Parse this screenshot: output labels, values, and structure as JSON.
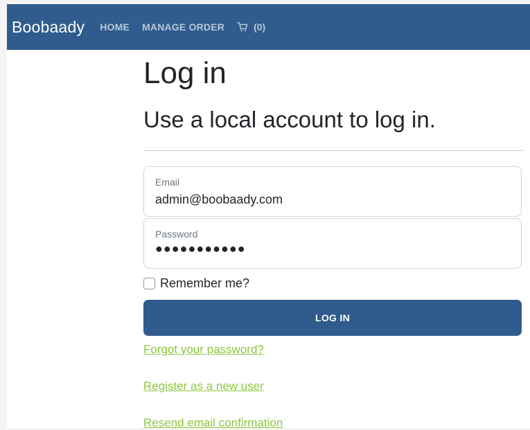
{
  "navbar": {
    "brand": "Boobaady",
    "links": [
      "HOME",
      "MANAGE ORDER"
    ],
    "cart_count": "(0)",
    "cart_icon": "cart-icon",
    "background_color": "#2f5c8c"
  },
  "page": {
    "title": "Log in",
    "subtitle": "Use a local account to log in."
  },
  "form": {
    "email_label": "Email",
    "email_value": "admin@boobaady.com",
    "password_label": "Password",
    "password_mask": "●●●●●●●●●●●",
    "remember_label": "Remember me?",
    "remember_checked": false,
    "submit_label": "LOG IN",
    "button_color": "#2f5c8c"
  },
  "links": {
    "forgot": "Forgot your password?",
    "register": "Register as a new user",
    "resend": "Resend email confirmation",
    "link_color": "#8cc63f"
  }
}
